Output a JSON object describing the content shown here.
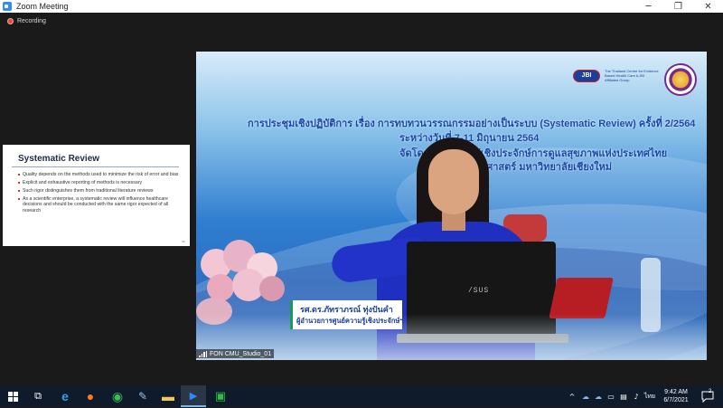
{
  "window": {
    "title": "Zoom Meeting",
    "controls": {
      "minimize": "─",
      "maximize": "❐",
      "close": "✕"
    }
  },
  "recording": {
    "label": "Recording"
  },
  "shared_slide": {
    "title": "Systematic Review",
    "bullets": [
      "Quality depends on the methods used to minimize the risk of error and bias",
      "Explicit and exhaustive reporting of methods is necessary",
      "Such rigor distinguishes them from traditional literature reviews",
      "As a scientific enterprise, a systematic review will influence healthcare decisions and should be conducted with the same rigor expected of all research"
    ],
    "footer": "JBI"
  },
  "video": {
    "jbi_logo": {
      "mark": "JBI",
      "text": "The Thailand Centre for Evidence Based Health Care A JBI Affiliated Group"
    },
    "banner": {
      "line1": "การประชุมเชิงปฏิบัติการ เรื่อง การทบทวนวรรณกรรมอย่างเป็นระบบ (Systematic Review) ครั้งที่ 2/2564",
      "line2": "ระหว่างวันที่ 7-11 มิถุนายน 2564",
      "line3": "จัดโดย ศูนย์ความรู้เชิงประจักษ์การดูแลสุขภาพแห่งประเทศไทย",
      "line4": "คณะพยาบาลศาสตร์ มหาวิทยาลัยเชียงใหม่"
    },
    "laptop_brand": "/SUS",
    "nameplate": {
      "name": "รศ.ดร.ภัทราภรณ์ ทุ่งปันคำ",
      "role": "ผู้อำนวยการศูนย์ความรู้เชิงประจักษ์ฯ"
    },
    "participant_name": "FON CMU_Studio_01"
  },
  "taskbar": {
    "start_icon": "windows-start-icon",
    "apps": [
      {
        "name": "task-view-icon",
        "glyph": "⧉"
      },
      {
        "name": "edge-icon",
        "glyph": "e",
        "color": "#2fa0e0"
      },
      {
        "name": "firefox-icon",
        "glyph": "●",
        "color": "#ff7a1a"
      },
      {
        "name": "chrome-icon",
        "glyph": "◉",
        "color": "#3cba54"
      },
      {
        "name": "pen-icon",
        "glyph": "✎",
        "color": "#9fc1e6"
      },
      {
        "name": "file-explorer-icon",
        "glyph": "▬",
        "color": "#f3c94a"
      },
      {
        "name": "zoom-icon",
        "glyph": "▶",
        "color": "#2d8cff"
      },
      {
        "name": "line-icon",
        "glyph": "▣",
        "color": "#2fbd42"
      }
    ],
    "tray": {
      "chevron": "^",
      "ime": "ไทย",
      "time": "9:42 AM",
      "date": "6/7/2021",
      "notification_count": "2"
    }
  }
}
